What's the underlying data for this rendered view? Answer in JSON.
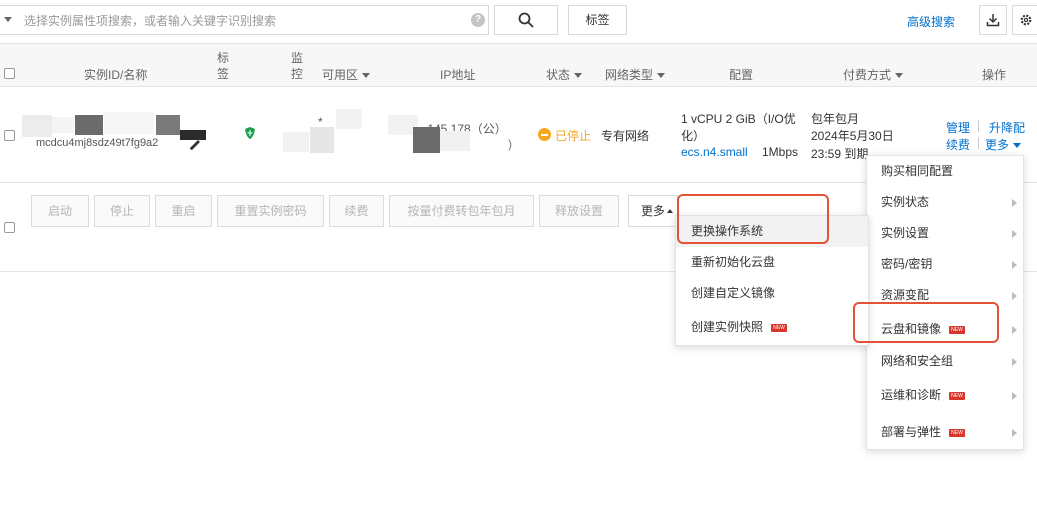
{
  "toolbar": {
    "search_placeholder": "选择实例属性项搜索，或者输入关键字识别搜索",
    "help": "?",
    "tag_label": "标签",
    "advanced_search": "高级搜索"
  },
  "table": {
    "headers": {
      "instance": "实例ID/名称",
      "tag": "标签",
      "monitor": "监控",
      "zone": "可用区",
      "ip": "IP地址",
      "status": "状态",
      "network": "网络类型",
      "config": "配置",
      "payment": "付费方式",
      "actions": "操作"
    },
    "row": {
      "instance_id_partial": "mcdcu4mj8sdz49t7fg9a2",
      "ip_partial": "-.145.178（公）",
      "ip_tail": ")",
      "zone_partial": "*",
      "status": "已停止",
      "network": "专有网络",
      "config_line1": "1 vCPU 2 GiB（I/O优",
      "config_line2": "化）",
      "config_type": "ecs.n4.small",
      "bandwidth": "1Mbps",
      "pay_line1": "包年包月",
      "pay_line2": "2024年5月30日",
      "pay_line3": "23:59 到期",
      "action_manage": "管理",
      "action_upgrade": "升降配",
      "action_renew": "续费",
      "action_more": "更多"
    }
  },
  "batch_actions": {
    "start": "启动",
    "stop": "停止",
    "restart": "重启",
    "reset_password": "重置实例密码",
    "renew": "续费",
    "convert": "按量付费转包年包月",
    "release": "释放设置",
    "more": "更多"
  },
  "right_menu": {
    "items": [
      {
        "label": "购买相同配置",
        "new": false,
        "submenu": false
      },
      {
        "label": "实例状态",
        "new": false,
        "submenu": true
      },
      {
        "label": "实例设置",
        "new": false,
        "submenu": true
      },
      {
        "label": "密码/密钥",
        "new": false,
        "submenu": true
      },
      {
        "label": "资源变配",
        "new": false,
        "submenu": true
      },
      {
        "label": "云盘和镜像",
        "new": true,
        "submenu": true
      },
      {
        "label": "网络和安全组",
        "new": false,
        "submenu": true
      },
      {
        "label": "运维和诊断",
        "new": true,
        "submenu": true
      },
      {
        "label": "部署与弹性",
        "new": true,
        "submenu": true
      }
    ]
  },
  "sub_menu": {
    "items": [
      {
        "label": "更换操作系统",
        "new": false
      },
      {
        "label": "重新初始化云盘",
        "new": false
      },
      {
        "label": "创建自定义镜像",
        "new": false
      },
      {
        "label": "创建实例快照",
        "new": true
      }
    ]
  },
  "badge_text": "NEW",
  "colors": {
    "link": "#0070cc",
    "stopped": "#f5a623",
    "highlight_box": "#e45239",
    "new_badge": "#d9362b"
  }
}
